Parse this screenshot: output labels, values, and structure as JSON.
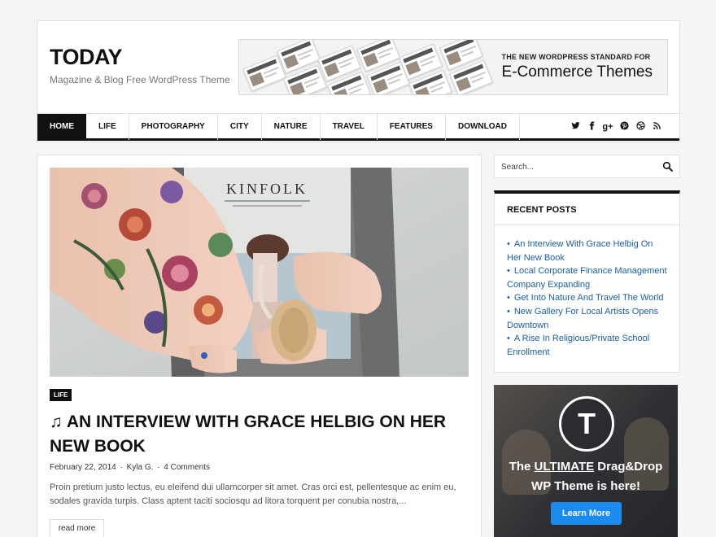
{
  "site": {
    "title": "TODAY",
    "tagline": "Magazine & Blog Free WordPress Theme"
  },
  "banner": {
    "small_text": "THE NEW WORDPRESS STANDARD FOR",
    "big_text": "E-Commerce Themes"
  },
  "nav": {
    "items": [
      "HOME",
      "LIFE",
      "PHOTOGRAPHY",
      "CITY",
      "NATURE",
      "TRAVEL",
      "FEATURES",
      "DOWNLOAD"
    ],
    "active": "HOME",
    "social_icons": [
      "twitter-icon",
      "facebook-icon",
      "google-plus-icon",
      "pinterest-icon",
      "dribbble-icon",
      "rss-icon"
    ]
  },
  "post": {
    "category": "LIFE",
    "title": "AN INTERVIEW WITH GRACE HELBIG ON HER NEW BOOK",
    "title_icon": "music-note-icon",
    "image_text": "KINFOLK",
    "date": "February 22, 2014",
    "author": "Kyla G.",
    "comments": "4 Comments",
    "excerpt": "Proin pretium justo lectus, eu eleifend dui ullamcorper sit amet. Cras orci est, pellentesque ac enim eu, sodales gravida turpis. Class aptent taciti sociosqu ad litora torquent per conubia nostra,...",
    "read_more": "read more"
  },
  "sidebar": {
    "search_placeholder": "Search...",
    "recent_title": "RECENT POSTS",
    "recent_posts": [
      "An Interview With Grace Helbig On Her New Book",
      "Local Corporate Finance Management Company Expanding",
      "Get Into Nature And Travel The World",
      "New Gallery For Local Artists Opens Downtown",
      "A Rise In Religious/Private School Enrollment"
    ],
    "ad": {
      "logo_letter": "T",
      "line1_prefix": "The ",
      "line1_emph": "ULTIMATE",
      "line1_suffix": " Drag&Drop",
      "line2": "WP Theme is here!",
      "button": "Learn More"
    }
  },
  "colors": {
    "accent": "#111111",
    "link": "#1a5fa8",
    "ad_button": "#1a8cf0"
  }
}
